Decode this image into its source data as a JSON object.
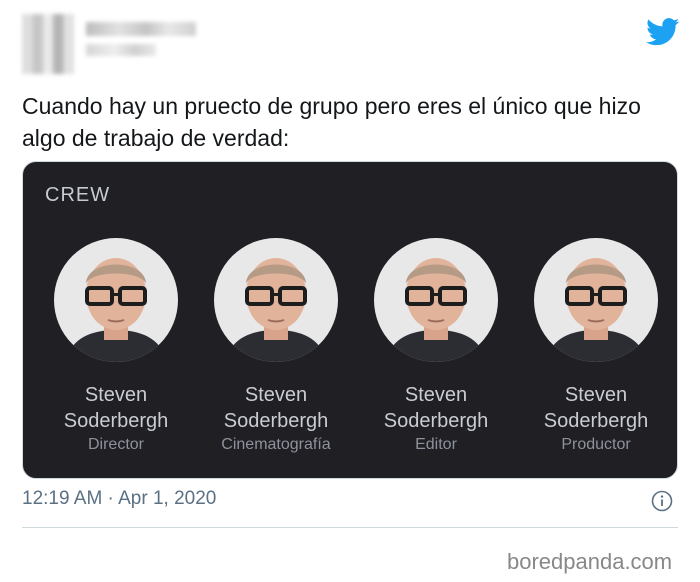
{
  "header": {
    "icon": "twitter-bird-icon",
    "icon_color": "#1da1f2"
  },
  "tweet": {
    "text": "Cuando hay un pruecto de grupo pero eres el único que hizo algo de trabajo de verdad:",
    "timestamp": "12:19 AM · Apr 1, 2020"
  },
  "card": {
    "title": "CREW",
    "background": "#1f1f24",
    "members": [
      {
        "name": "Steven Soderbergh",
        "role": "Director"
      },
      {
        "name": "Steven Soderbergh",
        "role": "Cinematografía"
      },
      {
        "name": "Steven Soderbergh",
        "role": "Editor"
      },
      {
        "name": "Steven Soderbergh",
        "role": "Productor"
      }
    ]
  },
  "watermark": "boredpanda.com"
}
